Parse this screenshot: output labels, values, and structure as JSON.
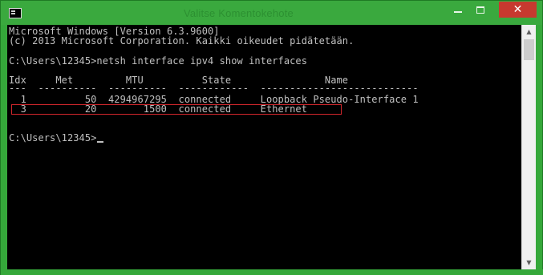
{
  "window": {
    "title": "Valitse Komentokehote",
    "minimize_glyph": "minimize",
    "maximize_glyph": "maximize",
    "close_label": "✕"
  },
  "console": {
    "lines": [
      "Microsoft Windows [Version 6.3.9600]",
      "(c) 2013 Microsoft Corporation. Kaikki oikeudet pidätetään.",
      "",
      "C:\\Users\\12345>netsh interface ipv4 show interfaces",
      "",
      "Idx     Met         MTU          State                Name",
      "---  ----------  ----------  ------------  ---------------------------",
      "  1          50  4294967295  connected     Loopback Pseudo-Interface 1",
      "  3          20        1500  connected     Ethernet",
      "",
      "",
      "C:\\Users\\12345>"
    ],
    "highlighted_row_index": 8
  },
  "colors": {
    "frame": "#35a83a",
    "console_bg": "#000000",
    "console_text": "#c0c0c0",
    "close_button": "#c7392f",
    "highlight_border": "#d0262c"
  },
  "icons": {
    "app": "cmd-icon",
    "scroll_up": "scroll-up-arrow-icon",
    "scroll_down": "scroll-down-arrow-icon"
  }
}
